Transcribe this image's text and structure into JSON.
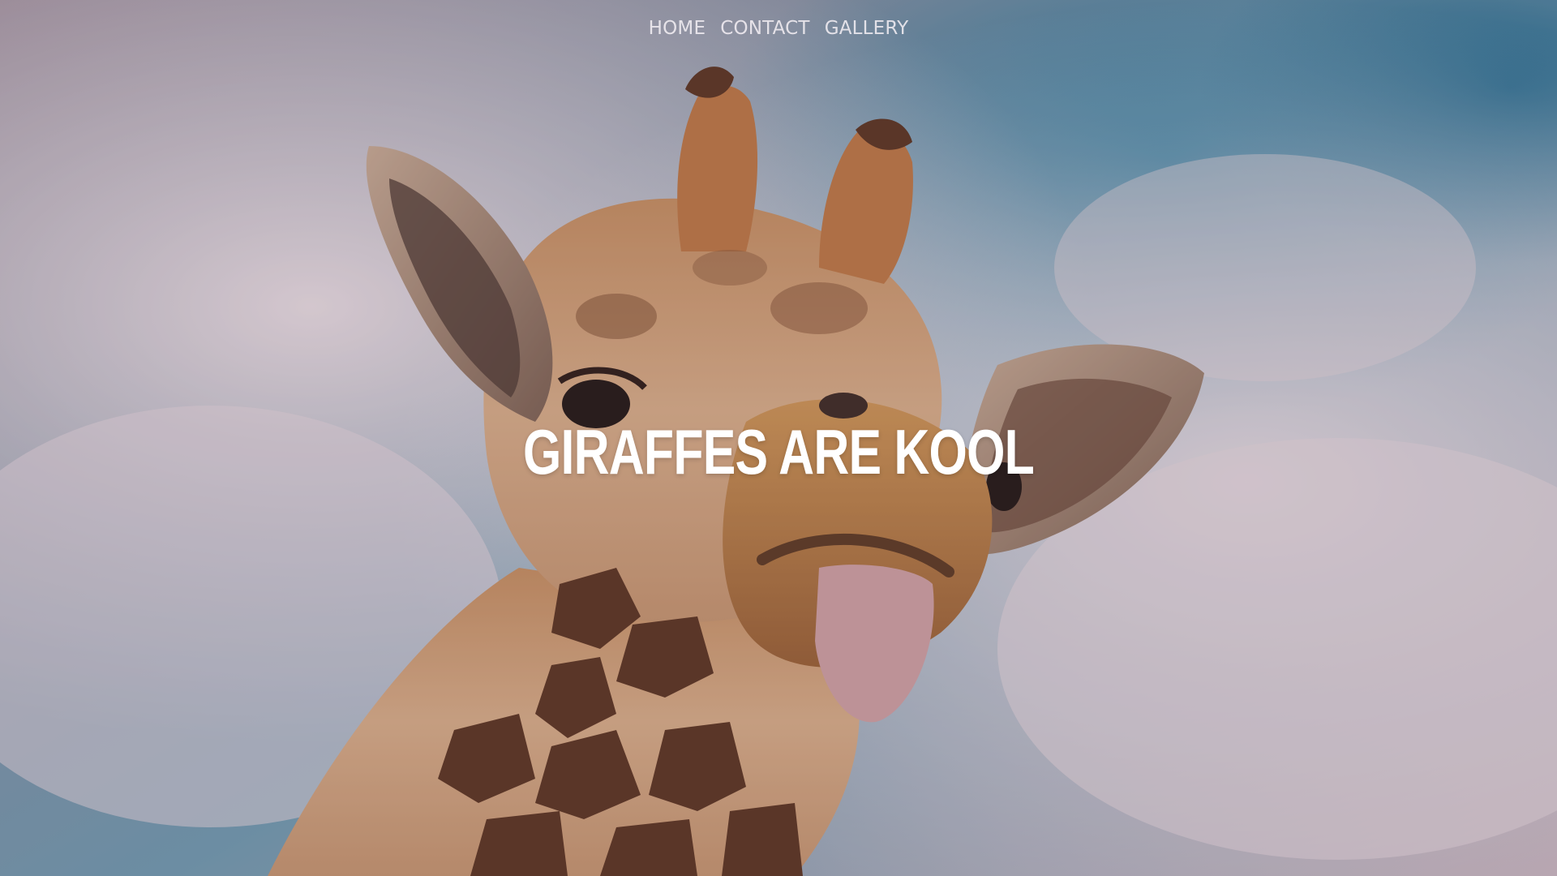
{
  "nav": {
    "items": [
      {
        "label": "HOME"
      },
      {
        "label": "CONTACT"
      },
      {
        "label": "GALLERY"
      }
    ]
  },
  "hero": {
    "headline": "GIRAFFES ARE KOOL",
    "image_subject": "giraffe-sticking-out-tongue-against-cloudy-sky"
  },
  "colors": {
    "sky_blue": "#3a8fb0",
    "cloud": "#e8dfe6",
    "giraffe_tan": "#c78b56",
    "giraffe_spots": "#5a3522",
    "overlay_tint": "#5c3c46",
    "headline": "#ffffff",
    "nav_text": "#f5f0f4"
  }
}
